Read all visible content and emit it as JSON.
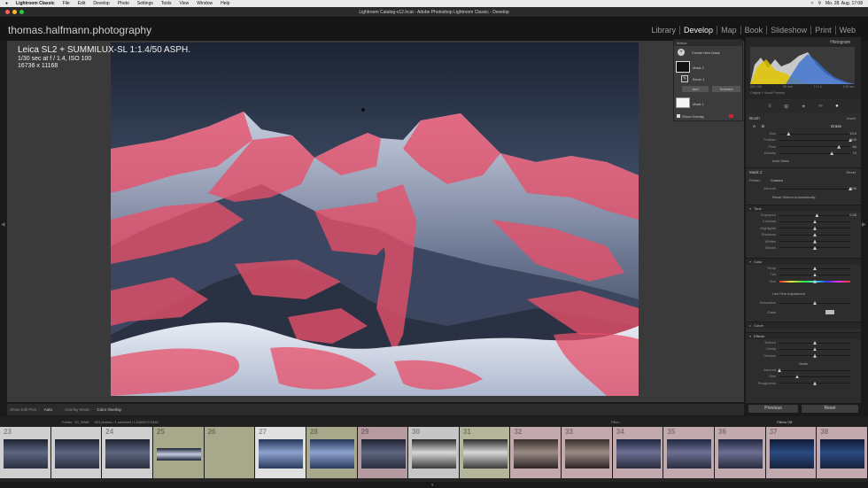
{
  "menubar": {
    "apple": "",
    "app": "Lightroom Classic",
    "items": [
      "File",
      "Edit",
      "Develop",
      "Photo",
      "Settings",
      "Tools",
      "View",
      "Window",
      "Help"
    ],
    "clock": "Mo. 28. Aug.  17:08"
  },
  "window_title": "Lightroom Catalog-v12.lrcat - Adobe Photoshop Lightroom Classic - Develop",
  "identity_plate": "thomas.halfmann.photography",
  "modules": [
    "Library",
    "Develop",
    "Map",
    "Book",
    "Slideshow",
    "Print",
    "Web"
  ],
  "active_module": "Develop",
  "photo_info": {
    "camera": "Leica SL2 + SUMMILUX-SL 1:1.4/50 ASPH.",
    "exposure": "1/30 sec at f / 1.4, ISO 100",
    "dimensions": "16736 x 11168"
  },
  "masks_panel": {
    "title": "Masks",
    "create": "Create New Mask",
    "mask2": "Mask 2",
    "brush1": "Brush 1",
    "add": "Add",
    "subtract": "Subtract",
    "mask1": "Mask 1",
    "show_overlay": "Show Overlay"
  },
  "histogram": {
    "title": "Histogram",
    "readouts": [
      "ISO 100",
      "50 mm",
      "f / 1.4",
      "1/30 sec"
    ],
    "preview_label": "Original + Smart Preview"
  },
  "brush": {
    "title": "Brush",
    "invert": "Invert",
    "ab_a": "A",
    "ab_b": "B",
    "erase": "Erase",
    "sliders": [
      {
        "label": "Size",
        "value": "13.0",
        "pos": 0.13
      },
      {
        "label": "Feather",
        "value": "100",
        "pos": 1.0
      },
      {
        "label": "Flow",
        "value": "84",
        "pos": 0.84
      },
      {
        "label": "Density",
        "value": "74",
        "pos": 0.74
      }
    ],
    "auto_mask": "Auto Mask"
  },
  "mask_settings": {
    "title": "Mask 2",
    "reset": "Reset",
    "preset_label": "Preset :",
    "preset_value": "Custom",
    "amount_label": "Amount",
    "amount_value": "100",
    "reset_sliders": "Reset Sliders Automatically"
  },
  "tone": {
    "title": "Tone",
    "sliders": [
      {
        "label": "Exposure",
        "value": "0.28",
        "pos": 0.53
      },
      {
        "label": "Contrast",
        "value": "",
        "pos": 0.5
      },
      {
        "label": "Highlights",
        "value": "",
        "pos": 0.5
      },
      {
        "label": "Shadows",
        "value": "",
        "pos": 0.5
      },
      {
        "label": "Whites",
        "value": "",
        "pos": 0.5
      },
      {
        "label": "Blacks",
        "value": "",
        "pos": 0.5
      }
    ]
  },
  "color": {
    "title": "Color",
    "sliders": [
      {
        "label": "Temp",
        "value": "",
        "pos": 0.5
      },
      {
        "label": "Tint",
        "value": "",
        "pos": 0.5
      },
      {
        "label": "Hue",
        "value": "",
        "pos": 0.5
      }
    ],
    "fine": "Use Fine Adjustment",
    "saturation": "Saturation",
    "color_label": "Color"
  },
  "curve": {
    "title": "Curve"
  },
  "effects": {
    "title": "Effects",
    "sliders": [
      {
        "label": "Texture",
        "value": "",
        "pos": 0.5
      },
      {
        "label": "Clarity",
        "value": "",
        "pos": 0.5
      },
      {
        "label": "Dehaze",
        "value": "",
        "pos": 0.5
      }
    ],
    "grain_title": "Grain",
    "grain": [
      {
        "label": "Amount",
        "value": "",
        "pos": 0.0
      },
      {
        "label": "Size",
        "value": "",
        "pos": 0.25
      },
      {
        "label": "Roughness",
        "value": "",
        "pos": 0.5
      }
    ]
  },
  "buttons": {
    "previous": "Previous",
    "reset": "Reset"
  },
  "toolbar": {
    "show_edit_pins_label": "Show Edit Pins :",
    "show_edit_pins_value": "Auto",
    "overlay_mode_label": "Overlay Mode :",
    "overlay_mode_value": "Color Overlay"
  },
  "filmstrip_bar": {
    "folder": "Folder : 01_RAW",
    "count": "991 photos / 1 selected / L1000572.DNG",
    "filter": "Filter :",
    "filters_off": "Filters Off"
  },
  "filmstrip": {
    "cells": [
      {
        "num": "23",
        "bg": "#cfcfcf",
        "thumb": "dark"
      },
      {
        "num": "",
        "bg": "#cfcfcf",
        "thumb": "dark"
      },
      {
        "num": "24",
        "bg": "#cfcfcf",
        "thumb": "dark"
      },
      {
        "num": "25",
        "bg": "#a7a98a",
        "thumb": "panoA"
      },
      {
        "num": "26",
        "bg": "#a7a98a",
        "thumb": "none"
      },
      {
        "num": "27",
        "bg": "#e0e0e0",
        "thumb": "blue"
      },
      {
        "num": "28",
        "bg": "#a7a98a",
        "thumb": "blue"
      },
      {
        "num": "29",
        "bg": "#b59aa0",
        "thumb": "dark"
      },
      {
        "num": "30",
        "bg": "#c6c6c6",
        "thumb": "bw"
      },
      {
        "num": "31",
        "bg": "#b5b59a",
        "thumb": "bw"
      },
      {
        "num": "32",
        "bg": "#c2a9ae",
        "thumb": "warm"
      },
      {
        "num": "33",
        "bg": "#c2a9ae",
        "thumb": "warm"
      },
      {
        "num": "34",
        "bg": "#c2a9ae",
        "thumb": "dusk"
      },
      {
        "num": "35",
        "bg": "#c2a9ae",
        "thumb": "dusk"
      },
      {
        "num": "36",
        "bg": "#c2a9ae",
        "thumb": "dusk"
      },
      {
        "num": "37",
        "bg": "#c2a9ae",
        "thumb": "night"
      },
      {
        "num": "38",
        "bg": "#c2a9ae",
        "thumb": "night"
      }
    ]
  },
  "colors": {
    "accent_red": "#d4202f",
    "overlay_pink": "#e8506a",
    "panel": "#2d2d2d"
  }
}
